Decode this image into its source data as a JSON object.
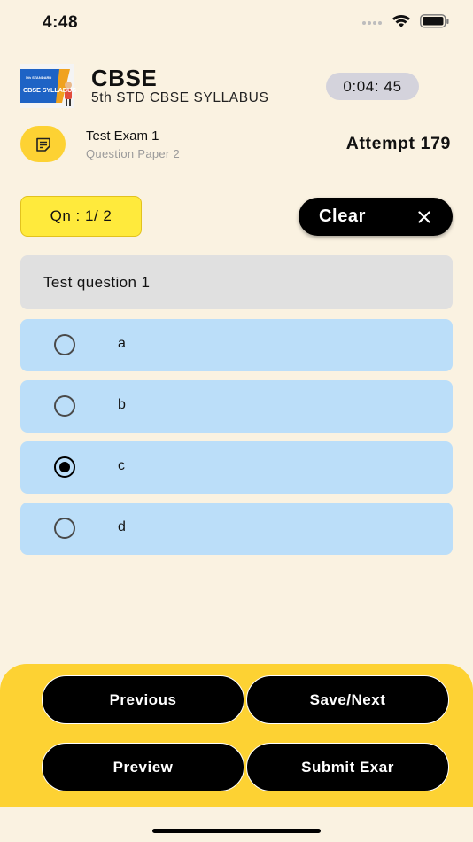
{
  "status_bar": {
    "time": "4:48"
  },
  "header": {
    "logo_text_top": "5th STANDARD",
    "logo_text": "CBSE SYLLABUS",
    "title": "CBSE",
    "subtitle": "5th STD CBSE SYLLABUS",
    "timer": "0:04: 45"
  },
  "exam": {
    "name": "Test Exam 1",
    "paper": "Question Paper 2",
    "attempt": "Attempt 179"
  },
  "question_counter": "Qn : 1/ 2",
  "clear_button": {
    "label": "Clear"
  },
  "question": {
    "text": "Test question 1"
  },
  "options": [
    {
      "label": "a",
      "selected": false
    },
    {
      "label": "b",
      "selected": false
    },
    {
      "label": "c",
      "selected": true
    },
    {
      "label": "d",
      "selected": false
    }
  ],
  "nav_buttons": {
    "previous": "Previous",
    "save_next": "Save/Next",
    "preview": "Preview",
    "submit": "Submit Exar"
  },
  "colors": {
    "background": "#FAF2E1",
    "accent_yellow": "#FDD233",
    "option_blue": "#BBDEF9",
    "question_gray": "#E0E0E0",
    "timer_bg": "#D4D3DC"
  }
}
